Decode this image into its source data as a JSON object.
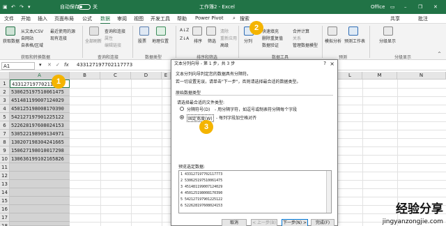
{
  "titlebar": {
    "autosave_label": "自动保存",
    "autosave_state": "关",
    "filename": "工作簿2 - Excel",
    "product": "Office",
    "window_controls": [
      "minimize-icon",
      "restore-icon",
      "close-icon"
    ]
  },
  "menu": {
    "tabs": [
      "文件",
      "开始",
      "插入",
      "页面布局",
      "公式",
      "数据",
      "审阅",
      "视图",
      "开发工具",
      "帮助",
      "Power Pivot"
    ],
    "active": "数据",
    "search": "搜索",
    "share": "共享",
    "comment": "批注"
  },
  "ribbon": {
    "get_data": "获取数据",
    "from_text_csv": "从文本/CSV",
    "from_web": "自网站",
    "from_table": "自表格/区域",
    "recent_sources": "最近使用的源",
    "existing_connections": "现有连接",
    "group_get_transform": "获取和转换数据",
    "refresh_all": "全部刷新",
    "queries_connections": "查询和连接",
    "properties": "属性",
    "edit_links": "编辑链接",
    "group_queries": "查询和连接",
    "stocks": "股票",
    "geography": "地理位置",
    "group_data_types": "数据类型",
    "sort_az": "A↓Z",
    "sort_za": "Z↓A",
    "sort": "排序",
    "filter": "筛选",
    "clear": "清除",
    "reapply": "重新应用",
    "advanced": "高级",
    "group_sort_filter": "排序和筛选",
    "text_to_columns": "分列",
    "flash_fill": "快速填充",
    "remove_duplicates": "删除重复值",
    "data_validation": "数据验证",
    "consolidate": "合并计算",
    "relationships": "关系",
    "manage_model": "管理数据模型",
    "group_data_tools": "数据工具",
    "what_if": "模拟分析",
    "forecast_sheet": "预测工作表",
    "group_forecast": "预测",
    "outline": "分级显示",
    "group_outline": "分级显示"
  },
  "formula": {
    "namebox": "A1",
    "value": "433127197702117773"
  },
  "sheet": {
    "columns": [
      "A",
      "B",
      "C",
      "D",
      "E",
      "F",
      "G",
      "H",
      "I",
      "J",
      "K",
      "L",
      "M",
      "N"
    ],
    "rows": [
      "1",
      "2",
      "3",
      "4",
      "5",
      "6",
      "7",
      "8",
      "9",
      "10",
      "11",
      "12",
      "13",
      "14",
      "15",
      "16",
      "17",
      "18"
    ],
    "cells": [
      "433127197702117773",
      "530625197510061475",
      "451481199007124029",
      "450125198008170390",
      "542127197901225122",
      "522628197608024153",
      "530522198909134971",
      "130207198304241665",
      "150627198010017298",
      "130636199102165826"
    ]
  },
  "badges": [
    "1",
    "2",
    "3"
  ],
  "dialog": {
    "title": "文本分列向导 - 第 1 步，共 3 步",
    "help": "?",
    "line1": "文本分列向导判定您的数据具有分隔符。",
    "line2": "若一切设置无误，请单击\"下一步\"，否则请选择最合适的数据类型。",
    "section": "原始数据类型",
    "choose": "请选择最合适的文件类型:",
    "opt1_label": "分隔符号(D)",
    "opt1_desc": "- 用分隔字符，如逗号或制表符分隔每个字段",
    "opt2_label": "固定宽度(W)",
    "opt2_desc": "- 每列字段加空格对齐",
    "selected_option": "固定宽度(W)",
    "preview_label": "预览选定数据:",
    "preview_rows": [
      "1 433127197702117773",
      "2 530625197510061475",
      "3 451481199007124029",
      "4 450125198008170390",
      "5 542127197901225122",
      "6 522628197608024153"
    ],
    "btn_cancel": "取消",
    "btn_back": "< 上一步(B)",
    "btn_next": "下一步(N) >",
    "btn_finish": "完成(F)"
  },
  "watermark": {
    "cn": "经验分享",
    "url": "jingyanzongjie.com"
  },
  "colors": {
    "excel_green": "#217346",
    "badge": "#f4b400",
    "selection": "#d3d3d3"
  }
}
